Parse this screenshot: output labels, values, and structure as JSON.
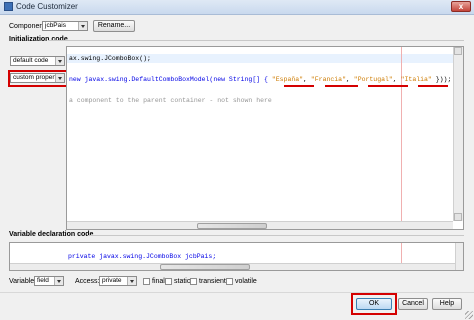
{
  "window": {
    "title": "Code Customizer",
    "close_glyph": "x"
  },
  "component": {
    "label": "Component:",
    "value": "jcbPais",
    "rename_label": "Rename..."
  },
  "init_section": {
    "title": "Initialization code",
    "default_dropdown": "default code",
    "custom_dropdown": "custom property",
    "line1": "ax.swing.JComboBox();",
    "line2_prefix": "new javax.swing.DefaultComboBoxModel(new String[] { ",
    "items": [
      "\"España\"",
      "\"Francia\"",
      "\"Portugal\"",
      "\"Italia\""
    ],
    "sep": ", ",
    "line2_suffix": " }));",
    "line3": "a component to the parent container - not shown here"
  },
  "var_section": {
    "title": "Variable declaration code",
    "line": "private javax.swing.JComboBox jcbPais;"
  },
  "variable_row": {
    "variable_label": "Variable:",
    "variable_value": "field",
    "access_label": "Access:",
    "access_value": "private",
    "checkboxes": [
      "final",
      "static",
      "transient",
      "volatile"
    ]
  },
  "buttons": {
    "ok": "OK",
    "cancel": "Cancel",
    "help": "Help"
  },
  "colors": {
    "accent_red": "#d40000",
    "keyword": "#0000e6",
    "string": "#ce7b00",
    "comment": "#969696"
  }
}
